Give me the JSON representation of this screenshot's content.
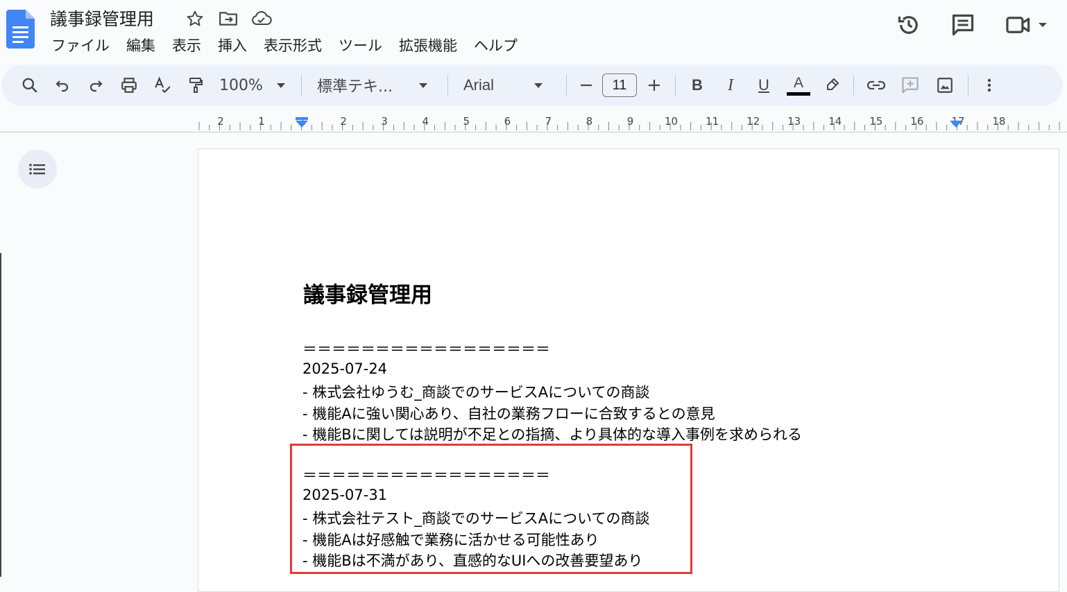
{
  "doc_title": "議事録管理用",
  "menu": [
    "ファイル",
    "編集",
    "表示",
    "挿入",
    "表示形式",
    "ツール",
    "拡張機能",
    "ヘルプ"
  ],
  "toolbar": {
    "zoom": "100%",
    "style": "標準テキ...",
    "font": "Arial",
    "font_size": "11",
    "bold_label": "B",
    "italic_label": "I",
    "underline_label": "U",
    "text_color_label": "A"
  },
  "ruler": {
    "ticks": [
      "2",
      "1",
      "1",
      "2",
      "3",
      "4",
      "5",
      "6",
      "7",
      "8",
      "9",
      "10",
      "11",
      "12",
      "13",
      "14",
      "15",
      "16",
      "17",
      "18"
    ]
  },
  "document": {
    "heading": "議事録管理用",
    "lines": [
      "＝＝＝＝＝＝＝＝＝＝＝＝＝＝＝＝＝",
      "2025-07-24",
      "- 株式会社ゆうむ_商談でのサービスAについての商談",
      "- 機能Aに強い関心あり、自社の業務フローに合致するとの意見",
      "- 機能Bに関しては説明が不足との指摘、より具体的な導入事例を求められる",
      "＝＝＝＝＝＝＝＝＝＝＝＝＝＝＝＝＝",
      "2025-07-31",
      "- 株式会社テスト_商談でのサービスAについての商談",
      "- 機能Aは好感触で業務に活かせる可能性あり",
      "- 機能Bは不満があり、直感的なUIへの改善要望あり"
    ]
  },
  "colors": {
    "highlight_border": "#e53935",
    "docs_blue": "#4285f4",
    "toolbar_bg": "#edf2fa"
  },
  "icons": [
    "docs-logo-icon",
    "star-icon",
    "move-to-folder-icon",
    "cloud-saved-icon",
    "history-icon",
    "comment-icon",
    "meet-video-icon",
    "search-icon",
    "undo-icon",
    "redo-icon",
    "print-icon",
    "spellcheck-icon",
    "paint-format-icon",
    "link-icon",
    "add-comment-icon",
    "insert-image-icon",
    "more-vert-icon",
    "outline-icon"
  ]
}
